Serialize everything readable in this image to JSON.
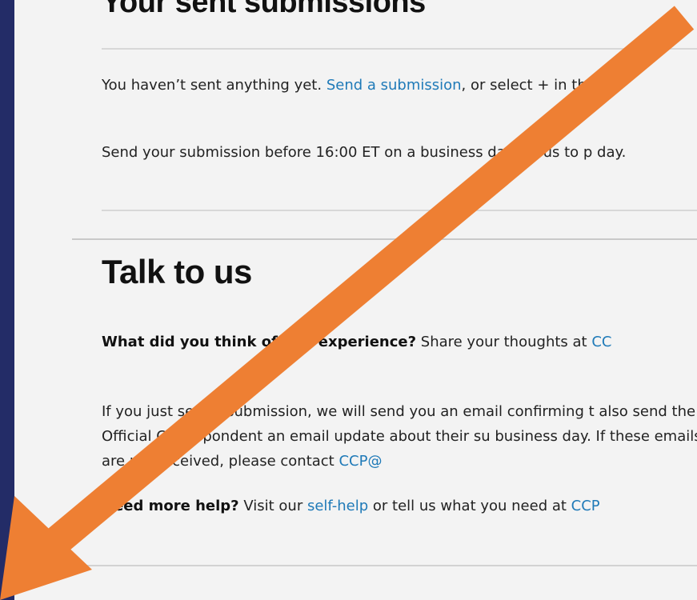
{
  "sent": {
    "title": "Your sent submissions",
    "empty_prefix": "You haven’t sent anything yet. ",
    "send_link": "Send a submission",
    "empty_suffix": ", or select + in the",
    "deadline": "Send your submission before 16:00 ET on a business day for us to p day."
  },
  "talk": {
    "title": "Talk to us",
    "feedback_bold": "What did you think of this experience?",
    "feedback_text": " Share your thoughts at ",
    "feedback_link": "CC",
    "confirm_text": "If you just sent a submission, we will send you an email confirming t also send the Official Correspondent an email update about their su business day. If these emails are not received, please contact ",
    "confirm_link": "CCP@",
    "help_bold": "Need more help?",
    "help_text1": " Visit our ",
    "help_link1": "self-help",
    "help_text2": " or tell us what you need at ",
    "help_link2": "CCP"
  },
  "colors": {
    "accent": "#1f7ab8",
    "rail": "#232c67",
    "arrow": "#ee7f33",
    "background": "#f3f3f3"
  },
  "icons": {
    "overlay": "arrow-down-left-icon"
  }
}
